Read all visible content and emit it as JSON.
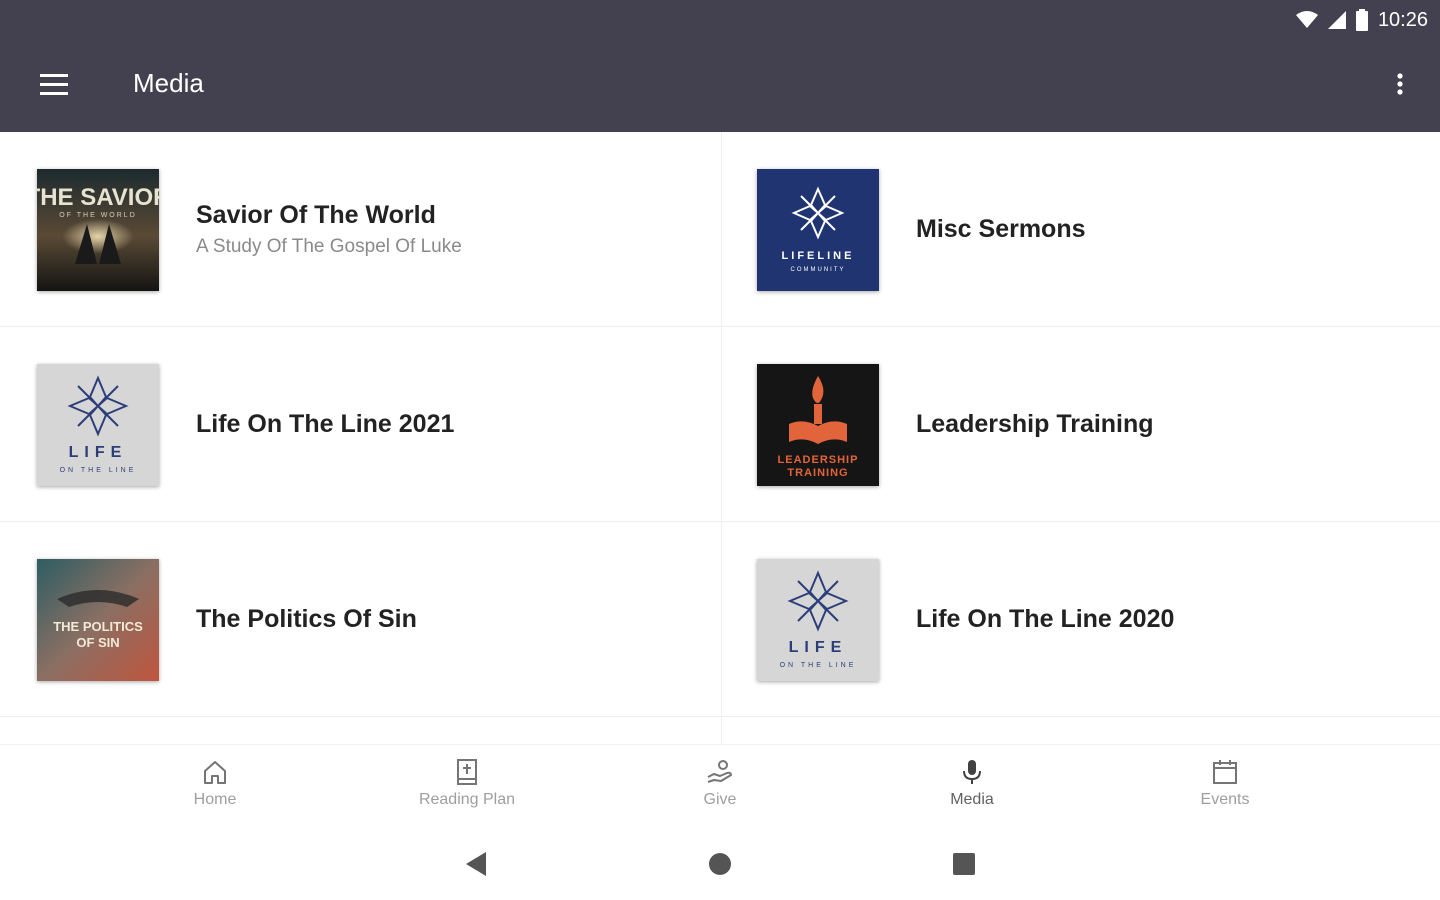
{
  "status": {
    "time": "10:26"
  },
  "appbar": {
    "title": "Media"
  },
  "items": [
    {
      "title": "Savior Of The World",
      "subtitle": "A Study Of The Gospel Of Luke",
      "thumb_text_line1": "THE SAVIOR",
      "thumb_text_line2": "OF THE WORLD"
    },
    {
      "title": "Misc Sermons",
      "thumb_text_line1": "LIFELINE",
      "thumb_text_line2": "COMMUNITY"
    },
    {
      "title": "Life On The Line 2021",
      "thumb_text_line1": "LIFE",
      "thumb_text_line2": "ON THE LINE"
    },
    {
      "title": "Leadership Training",
      "thumb_text_line1": "LEADERSHIP",
      "thumb_text_line2": "TRAINING"
    },
    {
      "title": "The Politics Of Sin",
      "thumb_text_line1": "THE POLITICS",
      "thumb_text_line2": "OF SIN"
    },
    {
      "title": "Life On The Line 2020",
      "thumb_text_line1": "LIFE",
      "thumb_text_line2": "ON THE LINE"
    }
  ],
  "bottom_nav": [
    {
      "label": "Home",
      "icon": "home-icon"
    },
    {
      "label": "Reading Plan",
      "icon": "bible-icon"
    },
    {
      "label": "Give",
      "icon": "give-icon"
    },
    {
      "label": "Media",
      "icon": "microphone-icon"
    },
    {
      "label": "Events",
      "icon": "calendar-icon"
    }
  ],
  "colors": {
    "appbar": "#43414f",
    "lifeline_blue": "#1f3470",
    "leadership_orange": "#e2643a"
  }
}
